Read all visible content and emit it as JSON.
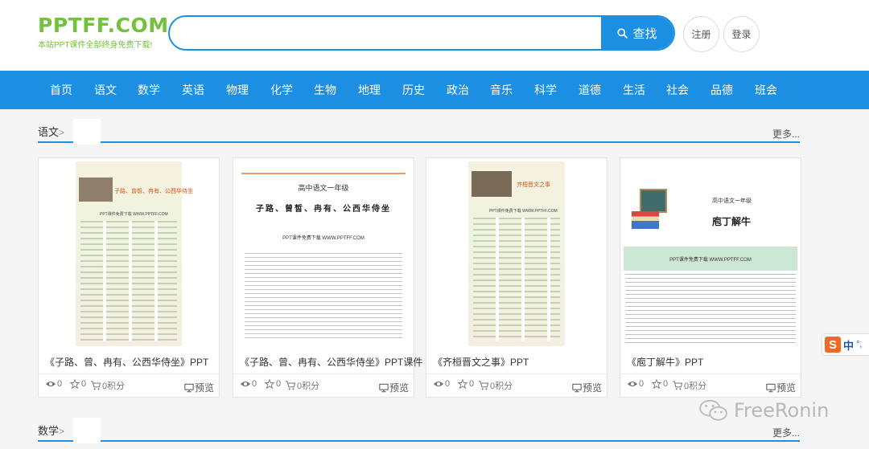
{
  "header": {
    "logo_text": "PPTFF.COM",
    "logo_sub": "本站PPT课件全部终身免费下载!",
    "search_placeholder": "",
    "search_button": "查找",
    "register": "注册",
    "login": "登录"
  },
  "nav": [
    "首页",
    "语文",
    "数学",
    "英语",
    "物理",
    "化学",
    "生物",
    "地理",
    "历史",
    "政治",
    "音乐",
    "科学",
    "道德",
    "生活",
    "社会",
    "品德",
    "班会"
  ],
  "sections": [
    {
      "title": "语文",
      "arrow": ">",
      "more": "更多..."
    },
    {
      "title": "数学",
      "arrow": ">",
      "more": "更多..."
    }
  ],
  "cards": [
    {
      "title": "《子路、曾、冉有、公西华侍坐》PPT",
      "thumb_heading": "子路、曾皙、冉有、公西华侍坐",
      "thumb_sub": "PPT课件免费下载 WWW.PPTFF.COM",
      "views": "0",
      "stars": "0",
      "points": "0积分",
      "preview": "预览"
    },
    {
      "title": "《子路、曾、冉有、公西华侍坐》PPT课件",
      "thumb_top": "高中语文一年级",
      "thumb_heading": "子路、曾皙、冉有、公西华侍坐",
      "thumb_sub": "PPT课件免费下载 WWW.PPTFF.COM",
      "views": "0",
      "stars": "0",
      "points": "0积分",
      "preview": "预览"
    },
    {
      "title": "《齐桓晋文之事》PPT",
      "thumb_heading": "齐桓晋文之事",
      "thumb_sub": "PPT课件免费下载 WWW.PPTFF.COM",
      "views": "0",
      "stars": "0",
      "points": "0积分",
      "preview": "预览"
    },
    {
      "title": "《庖丁解牛》PPT",
      "thumb_top": "高中语文一年级",
      "thumb_heading": "庖丁解牛",
      "thumb_sub": "PPT课件免费下载 WWW.PPTFF.COM",
      "views": "0",
      "stars": "0",
      "points": "0积分",
      "preview": "预览"
    }
  ],
  "ime": {
    "logo": "S",
    "lang": "中",
    "punct": "°,"
  },
  "watermark": "FreeRonin",
  "colors": {
    "primary": "#1c8fe3",
    "logo_green": "#74c23b"
  }
}
